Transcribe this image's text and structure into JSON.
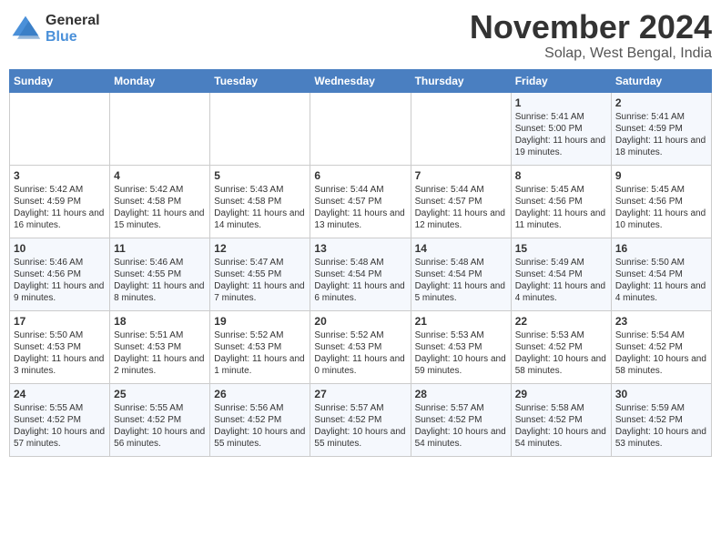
{
  "header": {
    "logo_general": "General",
    "logo_blue": "Blue",
    "month": "November 2024",
    "location": "Solap, West Bengal, India"
  },
  "weekdays": [
    "Sunday",
    "Monday",
    "Tuesday",
    "Wednesday",
    "Thursday",
    "Friday",
    "Saturday"
  ],
  "rows": [
    [
      {
        "day": "",
        "content": ""
      },
      {
        "day": "",
        "content": ""
      },
      {
        "day": "",
        "content": ""
      },
      {
        "day": "",
        "content": ""
      },
      {
        "day": "",
        "content": ""
      },
      {
        "day": "1",
        "content": "Sunrise: 5:41 AM\nSunset: 5:00 PM\nDaylight: 11 hours and 19 minutes."
      },
      {
        "day": "2",
        "content": "Sunrise: 5:41 AM\nSunset: 4:59 PM\nDaylight: 11 hours and 18 minutes."
      }
    ],
    [
      {
        "day": "3",
        "content": "Sunrise: 5:42 AM\nSunset: 4:59 PM\nDaylight: 11 hours and 16 minutes."
      },
      {
        "day": "4",
        "content": "Sunrise: 5:42 AM\nSunset: 4:58 PM\nDaylight: 11 hours and 15 minutes."
      },
      {
        "day": "5",
        "content": "Sunrise: 5:43 AM\nSunset: 4:58 PM\nDaylight: 11 hours and 14 minutes."
      },
      {
        "day": "6",
        "content": "Sunrise: 5:44 AM\nSunset: 4:57 PM\nDaylight: 11 hours and 13 minutes."
      },
      {
        "day": "7",
        "content": "Sunrise: 5:44 AM\nSunset: 4:57 PM\nDaylight: 11 hours and 12 minutes."
      },
      {
        "day": "8",
        "content": "Sunrise: 5:45 AM\nSunset: 4:56 PM\nDaylight: 11 hours and 11 minutes."
      },
      {
        "day": "9",
        "content": "Sunrise: 5:45 AM\nSunset: 4:56 PM\nDaylight: 11 hours and 10 minutes."
      }
    ],
    [
      {
        "day": "10",
        "content": "Sunrise: 5:46 AM\nSunset: 4:56 PM\nDaylight: 11 hours and 9 minutes."
      },
      {
        "day": "11",
        "content": "Sunrise: 5:46 AM\nSunset: 4:55 PM\nDaylight: 11 hours and 8 minutes."
      },
      {
        "day": "12",
        "content": "Sunrise: 5:47 AM\nSunset: 4:55 PM\nDaylight: 11 hours and 7 minutes."
      },
      {
        "day": "13",
        "content": "Sunrise: 5:48 AM\nSunset: 4:54 PM\nDaylight: 11 hours and 6 minutes."
      },
      {
        "day": "14",
        "content": "Sunrise: 5:48 AM\nSunset: 4:54 PM\nDaylight: 11 hours and 5 minutes."
      },
      {
        "day": "15",
        "content": "Sunrise: 5:49 AM\nSunset: 4:54 PM\nDaylight: 11 hours and 4 minutes."
      },
      {
        "day": "16",
        "content": "Sunrise: 5:50 AM\nSunset: 4:54 PM\nDaylight: 11 hours and 4 minutes."
      }
    ],
    [
      {
        "day": "17",
        "content": "Sunrise: 5:50 AM\nSunset: 4:53 PM\nDaylight: 11 hours and 3 minutes."
      },
      {
        "day": "18",
        "content": "Sunrise: 5:51 AM\nSunset: 4:53 PM\nDaylight: 11 hours and 2 minutes."
      },
      {
        "day": "19",
        "content": "Sunrise: 5:52 AM\nSunset: 4:53 PM\nDaylight: 11 hours and 1 minute."
      },
      {
        "day": "20",
        "content": "Sunrise: 5:52 AM\nSunset: 4:53 PM\nDaylight: 11 hours and 0 minutes."
      },
      {
        "day": "21",
        "content": "Sunrise: 5:53 AM\nSunset: 4:53 PM\nDaylight: 10 hours and 59 minutes."
      },
      {
        "day": "22",
        "content": "Sunrise: 5:53 AM\nSunset: 4:52 PM\nDaylight: 10 hours and 58 minutes."
      },
      {
        "day": "23",
        "content": "Sunrise: 5:54 AM\nSunset: 4:52 PM\nDaylight: 10 hours and 58 minutes."
      }
    ],
    [
      {
        "day": "24",
        "content": "Sunrise: 5:55 AM\nSunset: 4:52 PM\nDaylight: 10 hours and 57 minutes."
      },
      {
        "day": "25",
        "content": "Sunrise: 5:55 AM\nSunset: 4:52 PM\nDaylight: 10 hours and 56 minutes."
      },
      {
        "day": "26",
        "content": "Sunrise: 5:56 AM\nSunset: 4:52 PM\nDaylight: 10 hours and 55 minutes."
      },
      {
        "day": "27",
        "content": "Sunrise: 5:57 AM\nSunset: 4:52 PM\nDaylight: 10 hours and 55 minutes."
      },
      {
        "day": "28",
        "content": "Sunrise: 5:57 AM\nSunset: 4:52 PM\nDaylight: 10 hours and 54 minutes."
      },
      {
        "day": "29",
        "content": "Sunrise: 5:58 AM\nSunset: 4:52 PM\nDaylight: 10 hours and 54 minutes."
      },
      {
        "day": "30",
        "content": "Sunrise: 5:59 AM\nSunset: 4:52 PM\nDaylight: 10 hours and 53 minutes."
      }
    ]
  ]
}
